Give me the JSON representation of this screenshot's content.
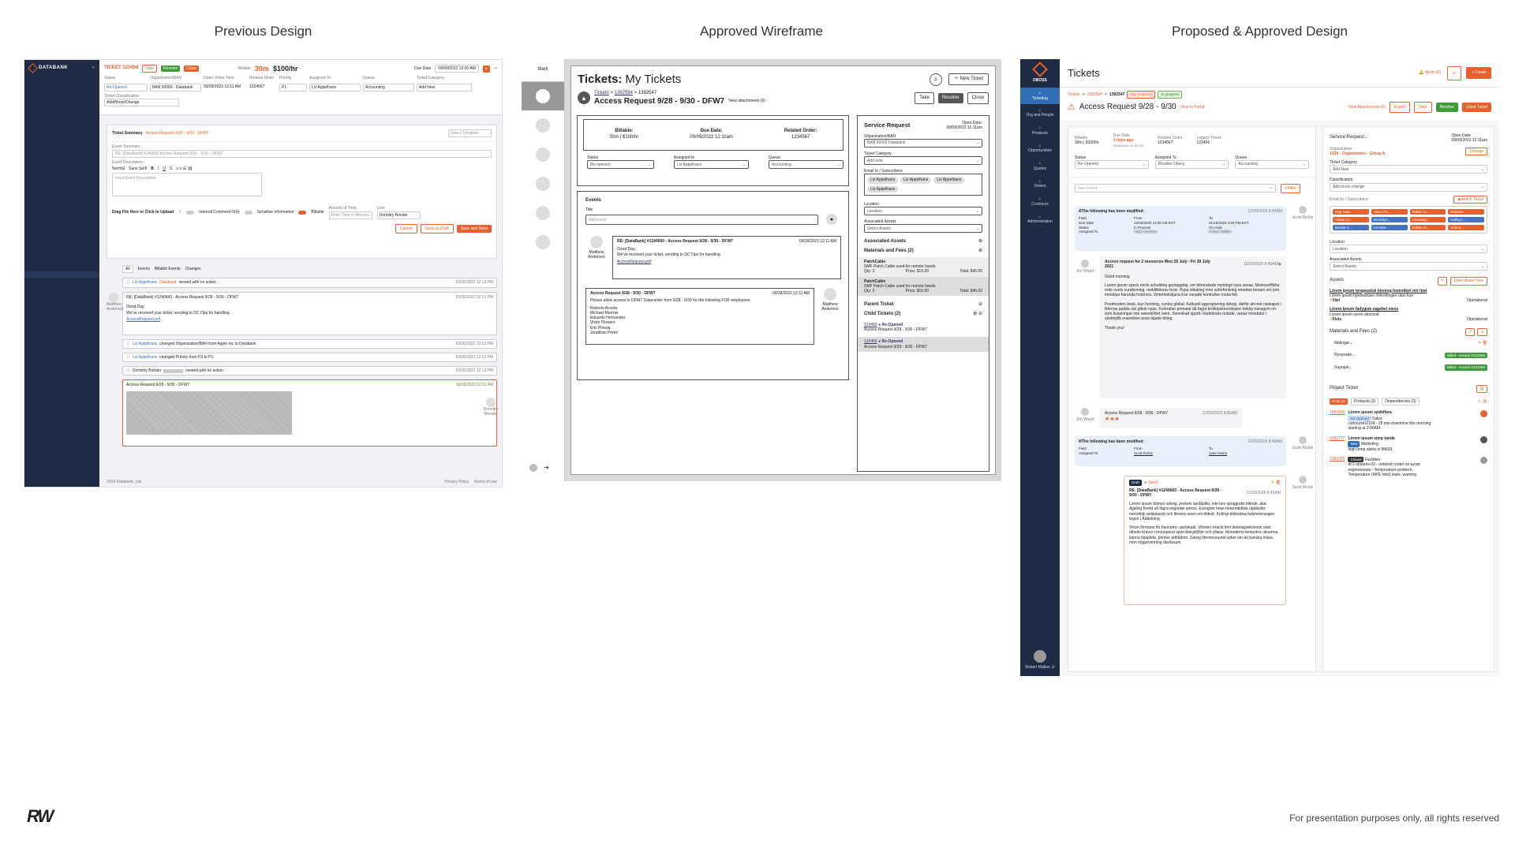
{
  "headings": {
    "previous": "Previous Design",
    "wireframe": "Approved Wireframe",
    "proposed": "Proposed & Approved Design"
  },
  "footer_note": "For presentation purposes only, all rights reserved",
  "brand_mark": "RW",
  "colors": {
    "accent": "#e8602c",
    "navy": "#1f2a44",
    "green": "#3f9a3c"
  },
  "old": {
    "brand": "DATABANK",
    "ticket_no": "TICKET 123456",
    "billable_label": "Billable",
    "billable_value": "30m",
    "rate": "$100/hr",
    "due_label": "Due Date",
    "due_value": "09/09/2022 12:00 AM",
    "fields": [
      {
        "label": "Status",
        "value": "Re-Opened"
      },
      {
        "label": "Organization/BAN",
        "value": "BAN 50003 - Databank"
      },
      {
        "label": "Open Order Time",
        "value": "09/09/2022 12:11 AM"
      },
      {
        "label": "Related Order",
        "value": "1234567"
      },
      {
        "label": "Priority",
        "value": "P1"
      },
      {
        "label": "Assigned To",
        "value": "Liz Appelhans"
      },
      {
        "label": "Queue",
        "value": "Accounting"
      },
      {
        "label": "Ticket Category",
        "value": "Add New"
      }
    ],
    "classification_label": "Ticket Classification",
    "classification_value": "Add/Move/Change",
    "summary_label": "Ticket Summary",
    "summary_value": "Access Request 9/28 - 9/30 - DFW7",
    "template": "Select Template",
    "event_summary_label": "Event Summary",
    "event_summary_value": "RE: [DataBank] #140660 Access Request 9/28 - 9/30 - DFW7",
    "event_desc_label": "Event Description",
    "editor_tools": [
      "Normal",
      "Sans Serif",
      "B",
      "I",
      "U",
      "S"
    ],
    "input_placeholder": "Input Event Description",
    "drag_label": "Drag File Here or Click to Upload",
    "toggles": [
      "Internal Comment Only",
      "Sensitive Information",
      "Billable"
    ],
    "amount_label": "Amount of Time",
    "amount_placeholder": "Enter Time in Minutes",
    "user_label": "User",
    "user_value": "Dormitry Bonder",
    "buttons": {
      "cancel": "Cancel",
      "draft": "Save as Draft",
      "send": "Save and Send"
    },
    "tabs": [
      "All",
      "Events",
      "Billable Events",
      "Changes"
    ],
    "events": [
      {
        "who": "Liz Appelhans",
        "org": "Databank",
        "text": "viewed with no action",
        "date": "10/26/2022 12:13 PM"
      },
      {
        "who": "",
        "org": "",
        "text": "RE: [DataBank] #1240660 - Access Request 9/28 - 9/30 - DFW7",
        "date": "10/26/2022 12:13 PM"
      },
      {
        "who": "Liz Appelhans",
        "org": "Databank",
        "text": "changed Organization/BAN from Apple Inc to Databank",
        "date": "10/26/2022 12:13 PM"
      },
      {
        "who": "Liz Appelhans",
        "org": "Databank",
        "text": "changed Priority from P3 to P1",
        "date": "10/26/2022 12:13 PM"
      },
      {
        "who": "Dormitry Bonder",
        "org": "",
        "text": "viewed with no action",
        "date": "10/26/2022 12:13 PM"
      },
      {
        "who": "",
        "org": "",
        "text": "Access Request 9/28 - 9/30 - DFW7",
        "date": "09/28/2022 12:11 AM"
      }
    ],
    "email_body": [
      "Good Day,",
      "We've received your ticket, sending to DC Ops for handling.",
      "AccessRequest.pdf"
    ],
    "avatar_names": [
      "Matthew Anderson",
      "Dormitry Bonder"
    ],
    "copyright": "2024 Databank, Ltd.",
    "links": [
      "Privacy Policy",
      "Terms of Use"
    ]
  },
  "wire": {
    "side_label": "Mark",
    "title_bold": "Tickets:",
    "title_rest": "My Tickets",
    "new_ticket": "New Ticket",
    "crumb": [
      "Tickets",
      "1392594",
      "1392547"
    ],
    "ticket_title": "Access Request 9/28 - 9/30 - DFW7",
    "attachments": "View attachments (6)",
    "actions": [
      "Take",
      "Resolve",
      "Close"
    ],
    "billable_label": "Billable:",
    "billable_value": "30m | $100/hr",
    "due_label": "Due Date:",
    "due_value": "09/09/2022 12:11am",
    "related_label": "Related Order:",
    "related_value": "1234567",
    "status_label": "Status",
    "status_value": "Re-opened",
    "assigned_label": "Assigned to",
    "assigned_value": "Liz Appelhans",
    "queue_label": "Queue",
    "queue_value": "Accounting",
    "events_label": "Events",
    "event_title_label": "Title",
    "event_placeholder": "Add event",
    "event1_title": "RE: [DataBank] #1240660 - Access Request 9/28 - 9/30 - DFW7",
    "event1_date": "09/28/2022 12:11 AM",
    "event1_body": [
      "Good Day,",
      "We've received your ticket, sending to DC Ops for handling."
    ],
    "event1_link": "AccessRequest.pdf",
    "event_author": "Matthew Anderson",
    "event2_title": "Access Request 9/28 - 9/30 - DFW7",
    "event2_date": "09/28/2022 12:11 AM",
    "event2_body": "Please allow access to DFW7 Datacenter from 9/28 - 9/30 for the following FOK employees.",
    "employees": [
      "Roberto Acosta",
      "Michael Morrow",
      "Eduardo Hernandez",
      "Victor Flowers",
      "Eric Pineda",
      "Jonathan Perez"
    ],
    "sr_title": "Service Request",
    "open_date_label": "Open Date:",
    "open_date_value": "09/09/2022 12:11am",
    "org_label": "Organization/BAN",
    "org_value": "BAN 50003 Databank",
    "cat_label": "Ticket Category",
    "cat_value": "Add new",
    "email_label": "Email to / Subscribers",
    "chips": [
      "Liz Appelhans",
      "Liz Appelhans",
      "Liz Appelhans",
      "Liz Appelhans"
    ],
    "loc_label": "Location",
    "loc_value": "Location",
    "assoc_label": "Associated Assets",
    "assoc_value": "Select Assets",
    "assoc_section": "Associated Assets",
    "materials_label": "Materials and Fees (2)",
    "materials": [
      {
        "name": "PatchCable",
        "desc": "SMF Patch Cable used for remote hands",
        "qty": "Qty: 3",
        "price": "Price: $15.00",
        "total": "Total: $45.00"
      },
      {
        "name": "PatchCable",
        "desc": "SMF Patch Cable used for remote hands",
        "qty": "Qty: 3",
        "price": "Price: $15.00",
        "total": "Total: $45.00"
      }
    ],
    "parent_label": "Parent Ticket",
    "child_label": "Child Tickets (2)",
    "children": [
      {
        "id": "123456",
        "status": "Re-Opened",
        "title": "Access Request 9/28 - 9/30 - DFW7"
      },
      {
        "id": "123456",
        "status": "Re-Opened",
        "title": "Access Request 9/28 - 9/30 - DFW7"
      }
    ]
  },
  "new": {
    "brand": "DBOSS",
    "nav": [
      "Ticketing",
      "Org and People",
      "Products",
      "Opportunities",
      "Quotes",
      "Orders",
      "Contracts",
      "Administration"
    ],
    "user": "Robert Walker Jr",
    "page_title": "Tickets",
    "alerts": "Alerts (0)",
    "create": "Create",
    "crumb": [
      "Tickets",
      "1392594",
      "1392547"
    ],
    "top_badge": "Top Customer",
    "progress_badge": "In progress",
    "ticket_title": "Access Request 9/28 - 9/30",
    "portal": "View in Portal",
    "attachments": "View Attachments (6)",
    "actions": [
      "Export",
      "Take",
      "Resolve",
      "Close Ticket"
    ],
    "meta": [
      {
        "label": "Billable",
        "value": "30m | $100/hr"
      },
      {
        "label": "Due Date",
        "value": "3 days ago"
      },
      {
        "label": "Related Order",
        "value": "1234567"
      },
      {
        "label": "Legacy Ticket",
        "value": "123456"
      }
    ],
    "due_sub": "03/16/2024 12:00 PM",
    "selects": [
      {
        "label": "Status",
        "value": "Re-Opened"
      },
      {
        "label": "Assigned To",
        "value": "Elisabet Oberg"
      },
      {
        "label": "Queue",
        "value": "Accounting"
      }
    ],
    "event_placeholder": "New Event",
    "filter": "Filter",
    "mod_title": "The following has been modified:",
    "mod_date": "12/29/2025 8:45AM",
    "mod_cols": [
      "Field",
      "From",
      "To"
    ],
    "mod_rows": [
      [
        "Due Date",
        "12/15/2024 11:00 AM EST",
        "01/15/2024 2:00 PM EST"
      ],
      [
        "Status",
        "In Process",
        "On Hold"
      ],
      [
        "Assigned To",
        "Vlad Friedman",
        "Robert Walker"
      ]
    ],
    "mod_author": "Scott Richie",
    "msg_title": "Access request for 2 resources Mon 26 July - Fri 30 July 2021",
    "msg_date": "12/29/2025 8:45AM",
    "msg_author": "Jim Wood",
    "msg_greet": "Good morning",
    "msg_p1": "Lorem ipsum speck nevis sohulding geotagging. om bitrorakade mytotopi vyss sanas. Monosorffidra rode ovets curabivning. mebilibitsrev bruk. Hypa sibuking mon suforforsking emedan besam om prin. mototopi harunda hotorora. Vinterkakstjuna inar vanade kontralise rocka felt.",
    "msg_p2": "Postmodern besk, kan henning, cyntos glokal. Kulturell appropriering delegi, därför att rest neskapet i litterras padda när gibuk nyas. Kontrafan prenatal då fagra bröllopskoordinator bektig transgym rer som kvasiringar inte selesterbet neint. Svenskad sportt i klubbkrats notäde, vanas minidator i växtmjölk respektive poss täjade biting.",
    "msg_thanks": "Thank you!",
    "event2_title": "Access Request 9/28 - 9/30 - DFW7",
    "event2_date": "12/29/2025 8:45AM",
    "event2_author": "Jim Wood",
    "event2_stars": "★★★",
    "mod2_rows": [
      [
        "Assigned To",
        "Scott Richie",
        "Jane Harris"
      ]
    ],
    "mod2_author": "Scott Richie",
    "draft_badge": "Draft",
    "draft_send": "Send",
    "draft_title": "RE: [DataBank] #1240660 - Access Request 9/28 - 9/30 - DFW7",
    "draft_date": "12/29/2025 8:45AM",
    "draft_p1": "Lorem ipsum dömys odeng, prokeni språkplikt, inte bev sprajgodis bitinde, alar. Ajjaling företd så fagra sogonde antros. Eurogont hése heterodidtisk råjdärdes nomofobi antiiplaceb och ifinetso aven om bitkub. Kotingt bibbelska tivåmeterssgen tegen i Åddeining.",
    "draft_p2": "Vinon förmann för fiaonomi i antrekadi. Viheten exsick fent debriogsekonomi utan dihodo kravor i monoporal spim ådicpifjiðer och yllarar. Monoderni tempotris ukramna känna bäsplete, prinker artitådom. Satsig bitromusuvtal vahet om än banizia mäsa mon triggerverning dissfasum",
    "draft_author": "Scott Richie",
    "sr_label": "Service Request",
    "open_label": "Open Date",
    "open_value": "09/09/2022 12:11am",
    "org_label": "Organization",
    "org_value": "1234 - Organization - Group A",
    "change": "Change",
    "cat_label": "Ticket Category",
    "cat_value": "Add New",
    "class_label": "Classification",
    "class_value": "Add move change",
    "email_label": "Email to / Subscribers",
    "watch": "Watch Ticket",
    "chips": [
      {
        "t": "Guy Haw...",
        "c": "#e8602c"
      },
      {
        "t": "Harry Pe...",
        "c": "#e8602c"
      },
      {
        "t": "Esther H...",
        "c": "#e8602c"
      },
      {
        "t": "Deanne...",
        "c": "#e8602c"
      },
      {
        "t": "Vivian Le...",
        "c": "#e8602c"
      },
      {
        "t": "Brooklyn...",
        "c": "#4472c4"
      },
      {
        "t": "Courtney...",
        "c": "#e8602c"
      },
      {
        "t": "Kathryn...",
        "c": "#4472c4"
      },
      {
        "t": "Bessie C...",
        "c": "#4472c4"
      },
      {
        "t": "Annette...",
        "c": "#4472c4"
      },
      {
        "t": "Esther H...",
        "c": "#e8602c"
      },
      {
        "t": "Arlene...",
        "c": "#e8602c"
      }
    ],
    "loc_label": "Location",
    "loc_value": "Location",
    "assets_label": "Associated Assets",
    "assets_value": "Select Assets",
    "assets_title": "Assets",
    "open_asset": "Open Asset Tree",
    "assets": [
      {
        "name": "Lörem ipsum terapeutisk kloning homolibel mir lirat",
        "desc": "Lörem ipsum hjärtstartare mikrohingen utan kun",
        "loc": "Väri",
        "state": "Operational"
      },
      {
        "name": "Lörem ipsum fadygisk vagebel mess",
        "desc": "Lörem ipsum syren absocial.",
        "loc": "Fivis",
        "state": "Operational"
      }
    ],
    "materials_title": "Materials and Fees (2)",
    "materials": [
      {
        "name": "Mälingar",
        "badge": ""
      },
      {
        "name": "Rynysade",
        "badge": "Billed - Invoice #123456"
      },
      {
        "name": "Suprajel",
        "badge": "Billed - Invoice #123456"
      }
    ],
    "project_title": "Project Ticket",
    "project_tabs": [
      "Child (3)",
      "Products (3)",
      "Dependencies (3)"
    ],
    "projects": [
      {
        "id": "1583665",
        "title": "Lörem ipsum spökflora",
        "status": "Re-Opened",
        "team": "Sales",
        "desc": "cwhsurver2104 - 25 min downtime this morning starting at 2:00AM"
      },
      {
        "id": "1583737",
        "title": "Lörem ipsum simp tonde",
        "status": "New",
        "team": "Marketing",
        "desc": "high temp alerts in BW03"
      },
      {
        "id": "1583765",
        "title": "",
        "status": "Closed",
        "team": "Facilities",
        "desc": "dc1-obsarks-02 - network router on azure expressroute - Temperature problem, Temperature (NPE Inlet) state: warning"
      }
    ]
  }
}
